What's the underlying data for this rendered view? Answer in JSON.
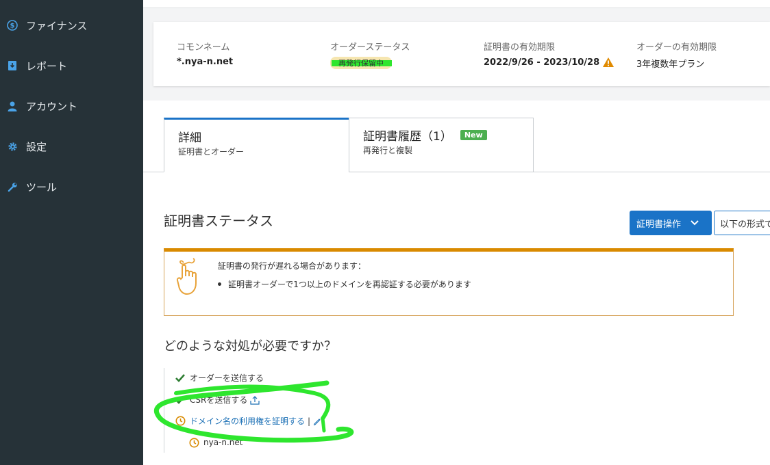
{
  "sidebar": {
    "items": [
      {
        "label": "ファイナンス",
        "icon": "dollar-circle-icon"
      },
      {
        "label": "レポート",
        "icon": "report-download-icon"
      },
      {
        "label": "アカウント",
        "icon": "user-icon"
      },
      {
        "label": "設定",
        "icon": "gear-icon"
      },
      {
        "label": "ツール",
        "icon": "wrench-icon"
      }
    ]
  },
  "summary": {
    "common_name_label": "コモンネーム",
    "common_name_value": "*.nya-n.net",
    "order_status_label": "オーダーステータス",
    "order_status_value": "再発行保留中",
    "cert_validity_label": "証明書の有効期限",
    "cert_validity_value": "2022/9/26 - 2023/10/28",
    "order_validity_label": "オーダーの有効期限",
    "order_validity_value": "3年複数年プラン"
  },
  "tabs": [
    {
      "title": "詳細",
      "subtitle": "証明書とオーダー"
    },
    {
      "title": "証明書履歴（1）",
      "subtitle": "再発行と複製",
      "badge": "New"
    }
  ],
  "section": {
    "title": "証明書ステータス",
    "primary_button": "証明書操作",
    "secondary_button": "以下の形式で"
  },
  "alert": {
    "title": "証明書の発行が遅れる場合があります：",
    "bullet": "証明書オーダーで1つ以上のドメインを再認証する必要があります"
  },
  "question": "どのような対処が必要ですか？",
  "steps": [
    {
      "label": "オーダーを送信する",
      "state": "done"
    },
    {
      "label": "CSRを送信する",
      "state": "done"
    },
    {
      "label": "ドメイン名の利用権を証明する",
      "state": "pending"
    },
    {
      "label": "nya-n.net",
      "state": "pending"
    }
  ],
  "colors": {
    "sidebar_bg": "#263238",
    "accent_blue": "#1a73c7",
    "alert_orange": "#d98a00",
    "check_green": "#2e7d32",
    "pending_orange": "#d98a00",
    "new_badge": "#4caf50",
    "annotation_green": "#2ee62e"
  }
}
